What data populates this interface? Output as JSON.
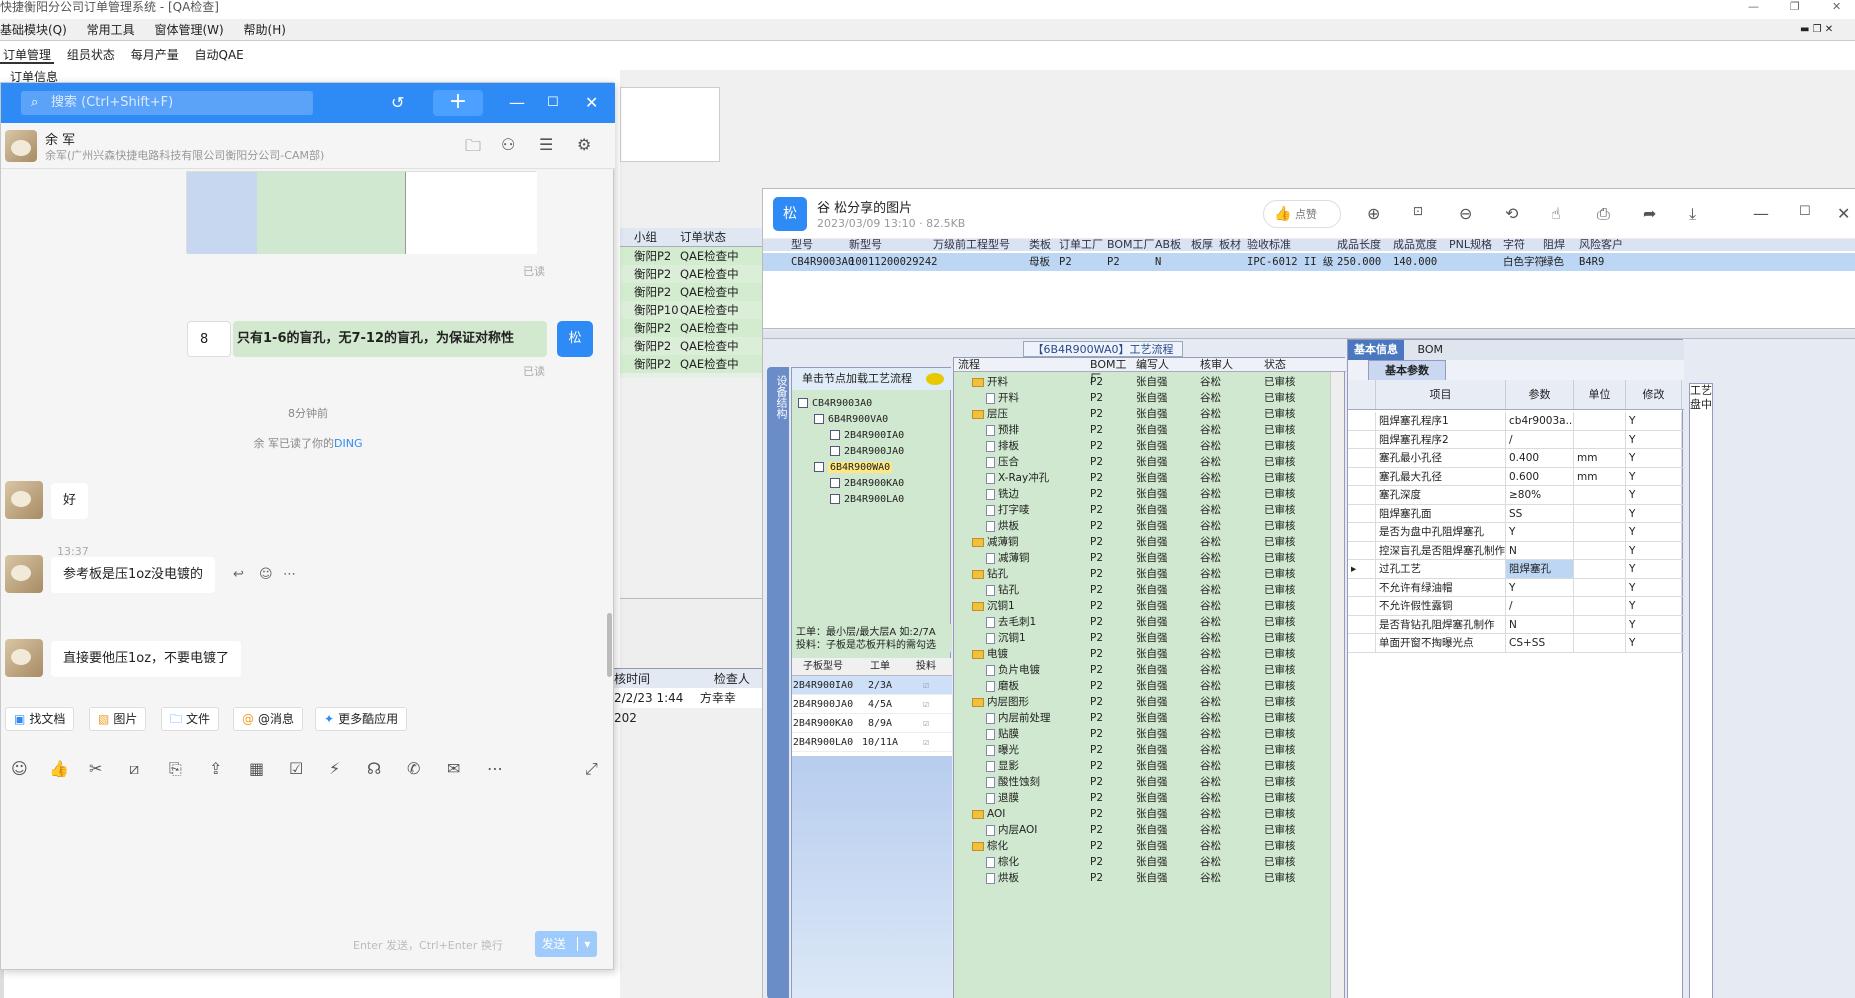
{
  "app": {
    "title": "快捷衡阳分公司订单管理系统 - [QA检查]",
    "menu": [
      "基础模块(Q)",
      "常用工具",
      "窗体管理(W)",
      "帮助(H)"
    ],
    "tabs": [
      "订单管理",
      "组员状态",
      "每月产量",
      "自动QAE"
    ],
    "panel_title": "订单信息",
    "order_header": [
      "小组",
      "订单状态"
    ],
    "order_rows": [
      [
        "衡阳P2",
        "QAE检查中"
      ],
      [
        "衡阳P2",
        "QAE检查中"
      ],
      [
        "衡阳P2",
        "QAE检查中"
      ],
      [
        "衡阳P10",
        "QAE检查中"
      ],
      [
        "衡阳P2",
        "QAE检查中"
      ],
      [
        "衡阳P2",
        "QAE检查中"
      ],
      [
        "衡阳P2",
        "QAE检查中"
      ]
    ],
    "footer_header": [
      "核时间",
      "检查人"
    ],
    "footer_row": [
      "2/2/23 1:44",
      "方幸幸",
      "202"
    ]
  },
  "chat": {
    "search_placeholder": "搜索 (Ctrl+Shift+F)",
    "contact_name": "余 军",
    "contact_sub": "余军(广州兴森快捷电路科技有限公司衡阳分公司-CAM部)",
    "read_label": "已读",
    "my_message_number": "8",
    "my_message": "只有1-6的盲孔，无7-12的盲孔，为保证对称性",
    "my_avatar_label": "松",
    "read_label2": "已读",
    "time_ago": "8分钟前",
    "ding_notice_prefix": "余 军已读了你的",
    "ding_word": "DING",
    "msg_ok": "好",
    "msg_time": "13:37",
    "msg_ref": "参考板是压1oz没电镀的",
    "msg_direct": "直接要他压1oz，不要电镀了",
    "tools": [
      "找文档",
      "图片",
      "文件",
      "@消息",
      "更多酷应用"
    ],
    "input_hint": "Enter 发送，Ctrl+Enter 换行",
    "send_label": "发送"
  },
  "viewer": {
    "logo": "松",
    "title": "谷 松分享的图片",
    "meta": "2023/03/09 13:10 · 82.5KB",
    "like_label": "点赞"
  },
  "shot": {
    "top_headers": [
      "型号",
      "新型号",
      "万级前工程型号",
      "类板",
      "订单工厂",
      "BOM工厂",
      "AB板",
      "板厚",
      "板材",
      "验收标准",
      "成品长度",
      "成品宽度",
      "PNL规格",
      "字符",
      "阻焊",
      "风险客户"
    ],
    "top_row": [
      "CB4R9003A0",
      "10011200029242",
      "",
      "母板",
      "P2",
      "P2",
      "N",
      "",
      "",
      "IPC-6012 II 级",
      "250.000",
      "140.000",
      "",
      "白色字符",
      "绿色",
      "B4R9"
    ],
    "flow_title": "【6B4R900WA0】工艺流程",
    "side_label": "设备结构",
    "tree_head": "单击节点加载工艺流程",
    "tree": [
      {
        "label": "CB4R9003A0",
        "level": 0,
        "selected": false
      },
      {
        "label": "6B4R900VA0",
        "level": 1,
        "selected": false
      },
      {
        "label": "2B4R900IA0",
        "level": 2,
        "selected": false
      },
      {
        "label": "2B4R900JA0",
        "level": 2,
        "selected": false
      },
      {
        "label": "6B4R900WA0",
        "level": 1,
        "selected": true
      },
      {
        "label": "2B4R900KA0",
        "level": 2,
        "selected": false
      },
      {
        "label": "2B4R900LA0",
        "level": 2,
        "selected": false
      }
    ],
    "layer_line1": "工单：最小层/最大层A 如:2/7A",
    "layer_line2": "投料：子板是芯板开料的需勾选",
    "sub_headers": [
      "子板型号",
      "工单",
      "投料"
    ],
    "sub_rows": [
      [
        "2B4R900IA0",
        "2/3A"
      ],
      [
        "2B4R900JA0",
        "4/5A"
      ],
      [
        "2B4R900KA0",
        "8/9A"
      ],
      [
        "2B4R900LA0",
        "10/11A"
      ]
    ],
    "proc_headers": [
      "流程",
      "BOM工厂",
      "编写人",
      "核审人",
      "状态"
    ],
    "proc_rows": [
      {
        "name": "开料",
        "group": true
      },
      {
        "name": "开料",
        "group": false
      },
      {
        "name": "层压",
        "group": true
      },
      {
        "name": "预排",
        "group": false
      },
      {
        "name": "排板",
        "group": false
      },
      {
        "name": "压合",
        "group": false
      },
      {
        "name": "X-Ray冲孔",
        "group": false
      },
      {
        "name": "铣边",
        "group": false
      },
      {
        "name": "打字唛",
        "group": false
      },
      {
        "name": "烘板",
        "group": false
      },
      {
        "name": "减薄铜",
        "group": true
      },
      {
        "name": "减薄铜",
        "group": false
      },
      {
        "name": "钻孔",
        "group": true
      },
      {
        "name": "钻孔",
        "group": false
      },
      {
        "name": "沉铜1",
        "group": true
      },
      {
        "name": "去毛刺1",
        "group": false
      },
      {
        "name": "沉铜1",
        "group": false
      },
      {
        "name": "电镀",
        "group": true
      },
      {
        "name": "负片电镀",
        "group": false
      },
      {
        "name": "磨板",
        "group": false
      },
      {
        "name": "内层图形",
        "group": true
      },
      {
        "name": "内层前处理",
        "group": false
      },
      {
        "name": "贴膜",
        "group": false
      },
      {
        "name": "曝光",
        "group": false
      },
      {
        "name": "显影",
        "group": false
      },
      {
        "name": "酸性蚀刻",
        "group": false
      },
      {
        "name": "退膜",
        "group": false
      },
      {
        "name": "AOI",
        "group": true
      },
      {
        "name": "内层AOI",
        "group": false
      },
      {
        "name": "棕化",
        "group": true
      },
      {
        "name": "棕化",
        "group": false
      },
      {
        "name": "烘板",
        "group": false
      }
    ],
    "proc_factory": "P2",
    "proc_writer": "张自强",
    "proc_reviewer": "谷松",
    "proc_status": "已审核",
    "basic_tab": "基本信息",
    "bom_tab": "BOM",
    "basic_sub": "基本参数",
    "basic_headers": [
      "项目",
      "参数",
      "单位",
      "修改"
    ],
    "basic_rows": [
      [
        "阻焊塞孔程序1",
        "cb4r9003a...",
        "",
        "Y"
      ],
      [
        "阻焊塞孔程序2",
        "/",
        "",
        "Y"
      ],
      [
        "塞孔最小孔径",
        "0.400",
        "mm",
        "Y"
      ],
      [
        "塞孔最大孔径",
        "0.600",
        "mm",
        "Y"
      ],
      [
        "塞孔深度",
        "≥80%",
        "",
        "Y"
      ],
      [
        "阻焊塞孔面",
        "SS",
        "",
        "Y"
      ],
      [
        "是否为盘中孔阻焊塞孔",
        "Y",
        "",
        "Y"
      ],
      [
        "控深盲孔是否阻焊塞孔制作",
        "N",
        "",
        "Y"
      ],
      [
        "过孔工艺",
        "阻焊塞孔",
        "",
        "Y"
      ],
      [
        "不允许有绿油帽",
        "Y",
        "",
        "Y"
      ],
      [
        "不允许假性露铜",
        "/",
        "",
        "Y"
      ],
      [
        "是否背钻孔阻焊塞孔制作",
        "N",
        "",
        "Y"
      ],
      [
        "单面开窗不掏曝光点",
        "CS+SS",
        "",
        "Y"
      ]
    ],
    "right_labels": [
      "工艺",
      "盘中"
    ]
  }
}
